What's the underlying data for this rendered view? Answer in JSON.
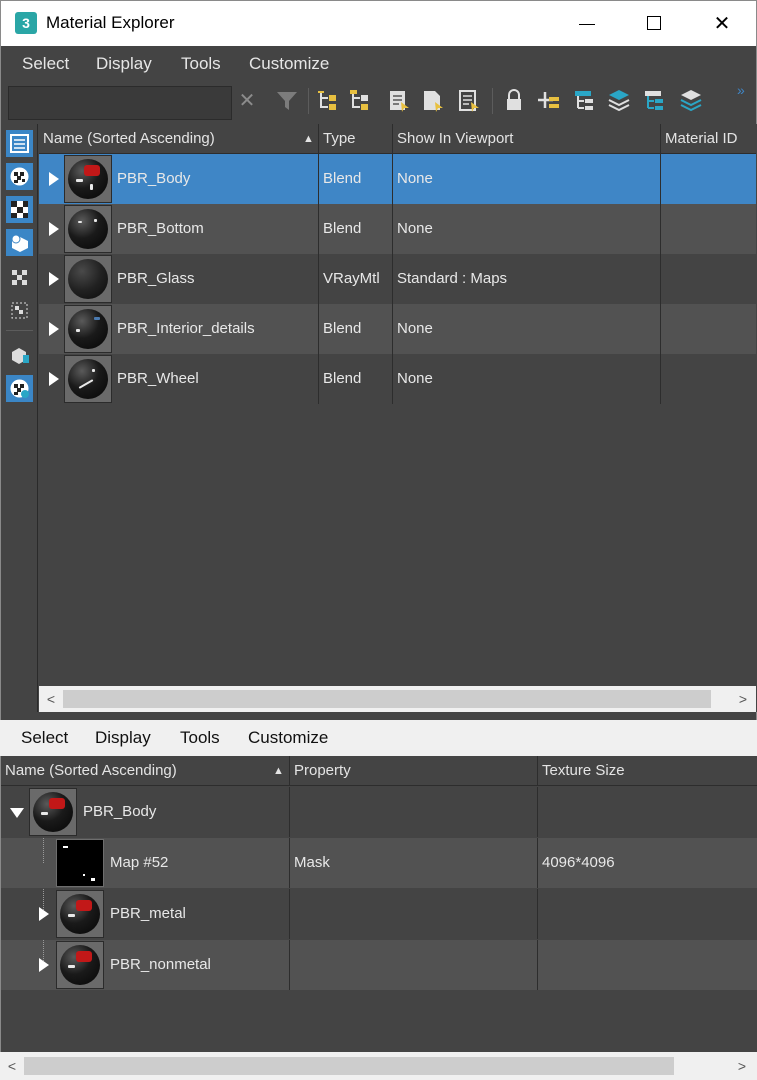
{
  "window": {
    "app_icon_text": "3",
    "title": "Material Explorer",
    "minimize_icon": "minimize-icon",
    "maximize_icon": "maximize-icon",
    "close_symbol": "✕"
  },
  "top_menu": [
    "Select",
    "Display",
    "Tools",
    "Customize"
  ],
  "toolbar": {
    "search_value": "",
    "search_placeholder": "",
    "clear_symbol": "✕",
    "more_symbol": "»",
    "icons": [
      "clear-search-icon",
      "filter-icon",
      "select-children-icon",
      "select-dependents-icon",
      "select-objects-icon",
      "select-materials-icon",
      "select-map-icon",
      "lock-icon",
      "add-icon",
      "hierarchy-icon",
      "layers-icon",
      "hierarchy-alt-icon",
      "layers-alt-icon",
      "overflow-icon"
    ]
  },
  "side_icons": [
    "list-view-icon",
    "material-checker-icon",
    "map-checker-icon",
    "object-icon",
    "checker-small-icon",
    "checker-empty-icon",
    "viewport-object-icon",
    "scene-material-icon"
  ],
  "upper_table": {
    "columns": [
      "Name (Sorted Ascending)",
      "Type",
      "Show In Viewport",
      "Material ID"
    ],
    "sort_symbol": "▲",
    "rows": [
      {
        "name": "PBR_Body",
        "type": "Blend",
        "show": "None",
        "id": ""
      },
      {
        "name": "PBR_Bottom",
        "type": "Blend",
        "show": "None",
        "id": ""
      },
      {
        "name": "PBR_Glass",
        "type": "VRayMtl",
        "show": "Standard : Maps",
        "id": ""
      },
      {
        "name": "PBR_Interior_details",
        "type": "Blend",
        "show": "None",
        "id": ""
      },
      {
        "name": "PBR_Wheel",
        "type": "Blend",
        "show": "None",
        "id": ""
      }
    ],
    "selected_index": 0
  },
  "bottom_menu": [
    "Select",
    "Display",
    "Tools",
    "Customize"
  ],
  "lower_table": {
    "columns": [
      "Name (Sorted Ascending)",
      "Property",
      "Texture Size"
    ],
    "sort_symbol": "▲",
    "rows": [
      {
        "name": "PBR_Body",
        "property": "",
        "size": ""
      },
      {
        "name": "Map #52",
        "property": "Mask",
        "size": "4096*4096"
      },
      {
        "name": "PBR_metal",
        "property": "",
        "size": ""
      },
      {
        "name": "PBR_nonmetal",
        "property": "",
        "size": ""
      }
    ]
  },
  "scroll": {
    "left_arrow": "<",
    "right_arrow": ">"
  },
  "colors": {
    "selection": "#3f86c6",
    "panel": "#444444",
    "row_alt": "#525252",
    "accent_teal": "#2aa6a6"
  }
}
